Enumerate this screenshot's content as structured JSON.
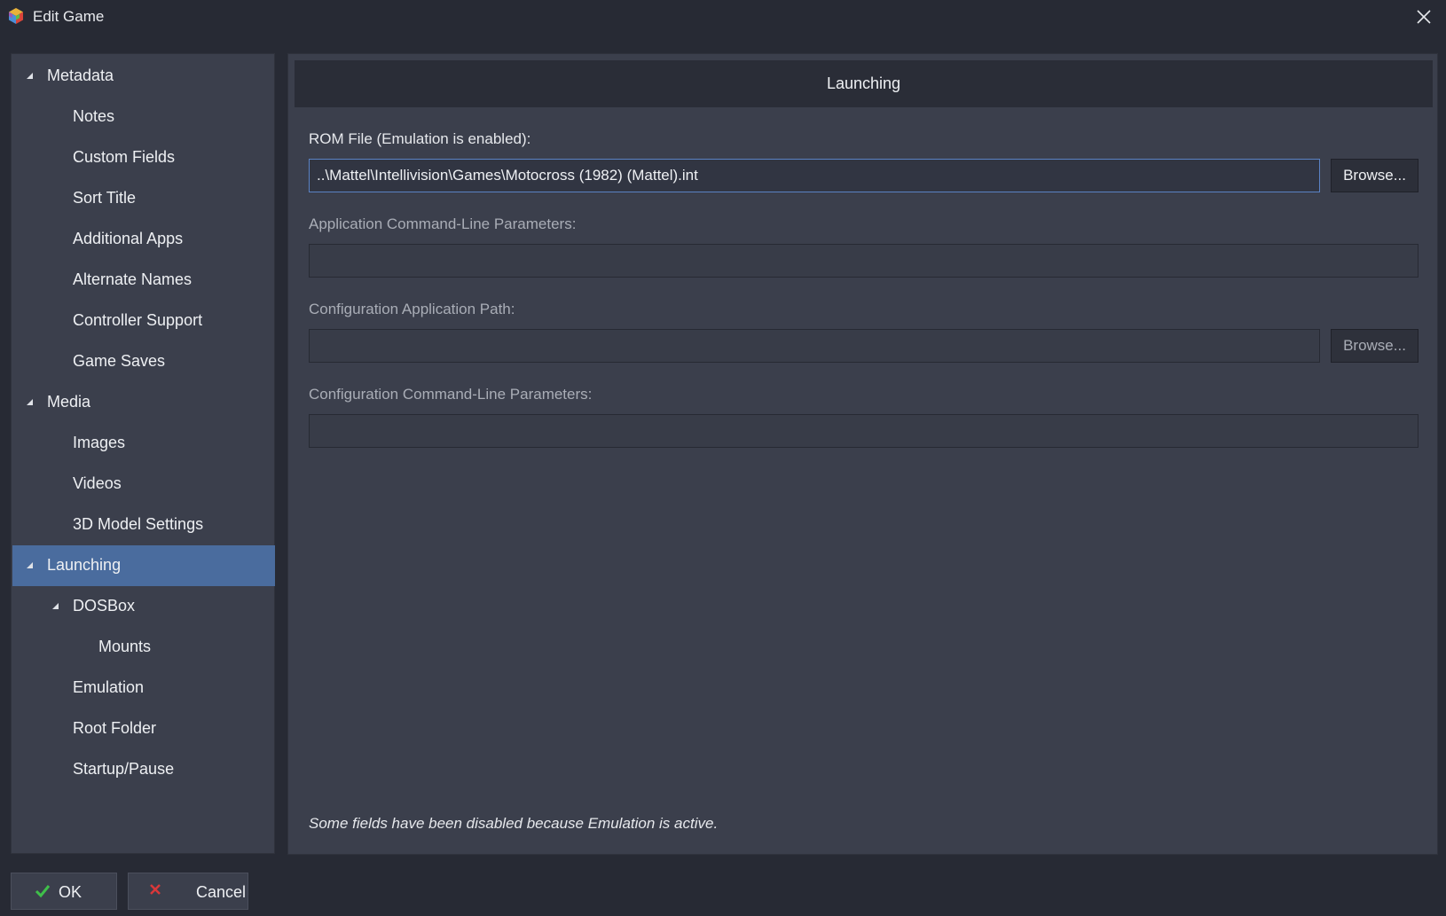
{
  "window": {
    "title": "Edit Game"
  },
  "sidebar": {
    "items": [
      {
        "label": "Metadata",
        "level": 0,
        "expanded": true
      },
      {
        "label": "Notes",
        "level": 1
      },
      {
        "label": "Custom Fields",
        "level": 1
      },
      {
        "label": "Sort Title",
        "level": 1
      },
      {
        "label": "Additional Apps",
        "level": 1
      },
      {
        "label": "Alternate Names",
        "level": 1
      },
      {
        "label": "Controller Support",
        "level": 1
      },
      {
        "label": "Game Saves",
        "level": 1
      },
      {
        "label": "Media",
        "level": 0,
        "expanded": true
      },
      {
        "label": "Images",
        "level": 1
      },
      {
        "label": "Videos",
        "level": 1
      },
      {
        "label": "3D Model Settings",
        "level": 1
      },
      {
        "label": "Launching",
        "level": 0,
        "expanded": true,
        "selected": true
      },
      {
        "label": "DOSBox",
        "level": 1,
        "expanded": true
      },
      {
        "label": "Mounts",
        "level": 2
      },
      {
        "label": "Emulation",
        "level": 1
      },
      {
        "label": "Root Folder",
        "level": 1
      },
      {
        "label": "Startup/Pause",
        "level": 1
      }
    ]
  },
  "main": {
    "header": "Launching",
    "rom_file": {
      "label": "ROM File (Emulation is enabled):",
      "value": "..\\Mattel\\Intellivision\\Games\\Motocross (1982) (Mattel).int",
      "browse_label": "Browse..."
    },
    "app_params": {
      "label": "Application Command-Line Parameters:",
      "value": ""
    },
    "config_app_path": {
      "label": "Configuration Application Path:",
      "value": "",
      "browse_label": "Browse..."
    },
    "config_params": {
      "label": "Configuration Command-Line Parameters:",
      "value": ""
    },
    "footnote": "Some fields have been disabled because Emulation is active."
  },
  "buttons": {
    "ok_label": "OK",
    "cancel_label": "Cancel"
  },
  "colors": {
    "background": "#272a34",
    "panel": "#3b3f4c",
    "selection": "#4a6c9e",
    "focus_border": "#5a82c4",
    "ok_check": "#3fbf4a",
    "cancel_x": "#d9383a"
  }
}
